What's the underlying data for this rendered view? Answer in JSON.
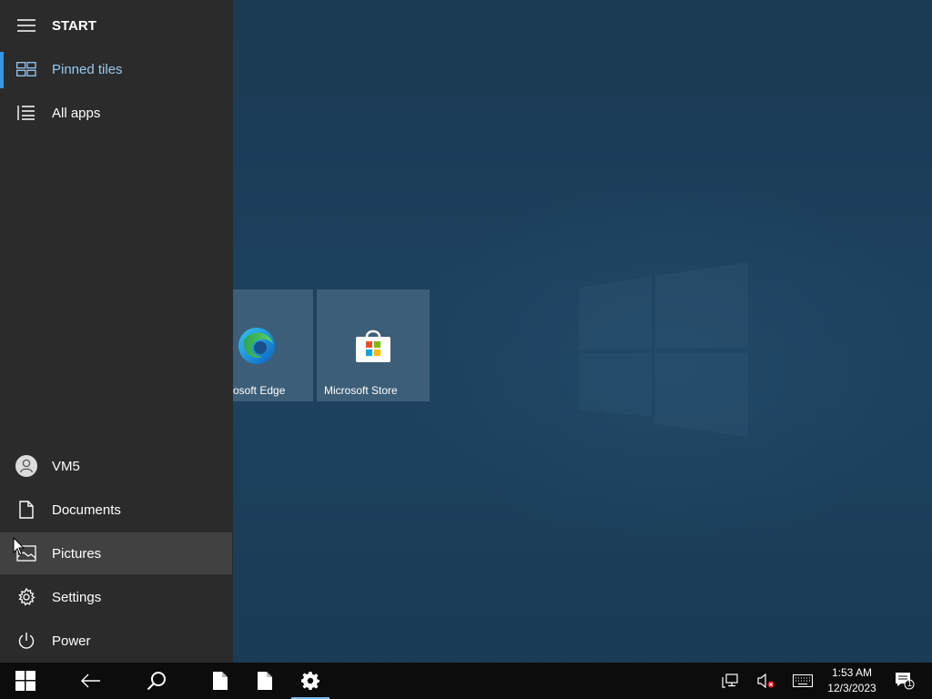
{
  "start_menu": {
    "title": "START",
    "nav": [
      {
        "label": "Pinned tiles",
        "icon": "tiles-icon",
        "active": true
      },
      {
        "label": "All apps",
        "icon": "list-icon",
        "active": false
      }
    ],
    "user": {
      "label": "VM5",
      "icon": "user-avatar-icon"
    },
    "places": [
      {
        "label": "Documents",
        "icon": "document-icon"
      },
      {
        "label": "Pictures",
        "icon": "pictures-icon"
      },
      {
        "label": "Settings",
        "icon": "gear-icon"
      },
      {
        "label": "Power",
        "icon": "power-icon"
      }
    ],
    "tiles": [
      {
        "label": "Microsoft Edge",
        "visible_label": "osoft Edge",
        "icon": "edge-icon"
      },
      {
        "label": "Microsoft Store",
        "icon": "store-icon"
      }
    ]
  },
  "taskbar": {
    "buttons": [
      "start-icon",
      "back-icon",
      "search-icon",
      "document-icon",
      "document-icon",
      "gear-icon"
    ],
    "tray": [
      "network-icon",
      "volume-muted-icon",
      "keyboard-icon"
    ],
    "clock": {
      "time": "1:53 AM",
      "date": "12/3/2023"
    },
    "notifications_count": "1"
  },
  "colors": {
    "accent": "#3a96dd",
    "rail_bg": "#2b2b2b",
    "taskbar_bg": "#0c0c0c",
    "hover_bg": "#414141"
  }
}
